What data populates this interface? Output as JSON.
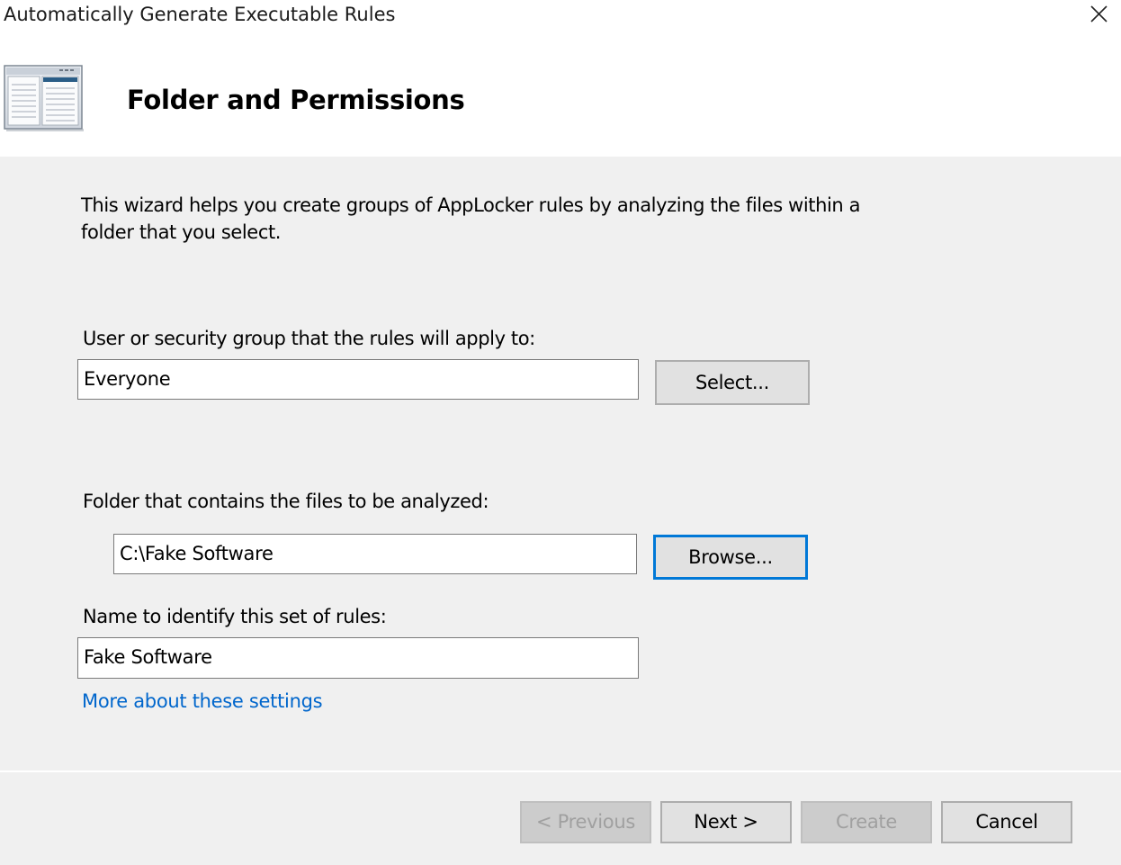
{
  "window": {
    "title": "Automatically Generate Executable Rules"
  },
  "header": {
    "title": "Folder and Permissions",
    "icon": "wizard-page-icon"
  },
  "intro_text": "This wizard helps you create groups of AppLocker rules by analyzing the files within a folder that you select.",
  "user_group": {
    "label": "User or security group that the rules will apply to:",
    "value": "Everyone",
    "button_label": "Select..."
  },
  "folder": {
    "label": "Folder that contains the files to be analyzed:",
    "value": "C:\\Fake Software",
    "button_label": "Browse..."
  },
  "rule_set_name": {
    "label": "Name to identify this set of rules:",
    "value": "Fake Software"
  },
  "more_link": "More about these settings",
  "footer": {
    "previous_label": "< Previous",
    "next_label": "Next >",
    "create_label": "Create",
    "cancel_label": "Cancel"
  },
  "colors": {
    "focus_border": "#0078d7",
    "link": "#0066cc",
    "disabled_text": "#a0a0a0"
  }
}
